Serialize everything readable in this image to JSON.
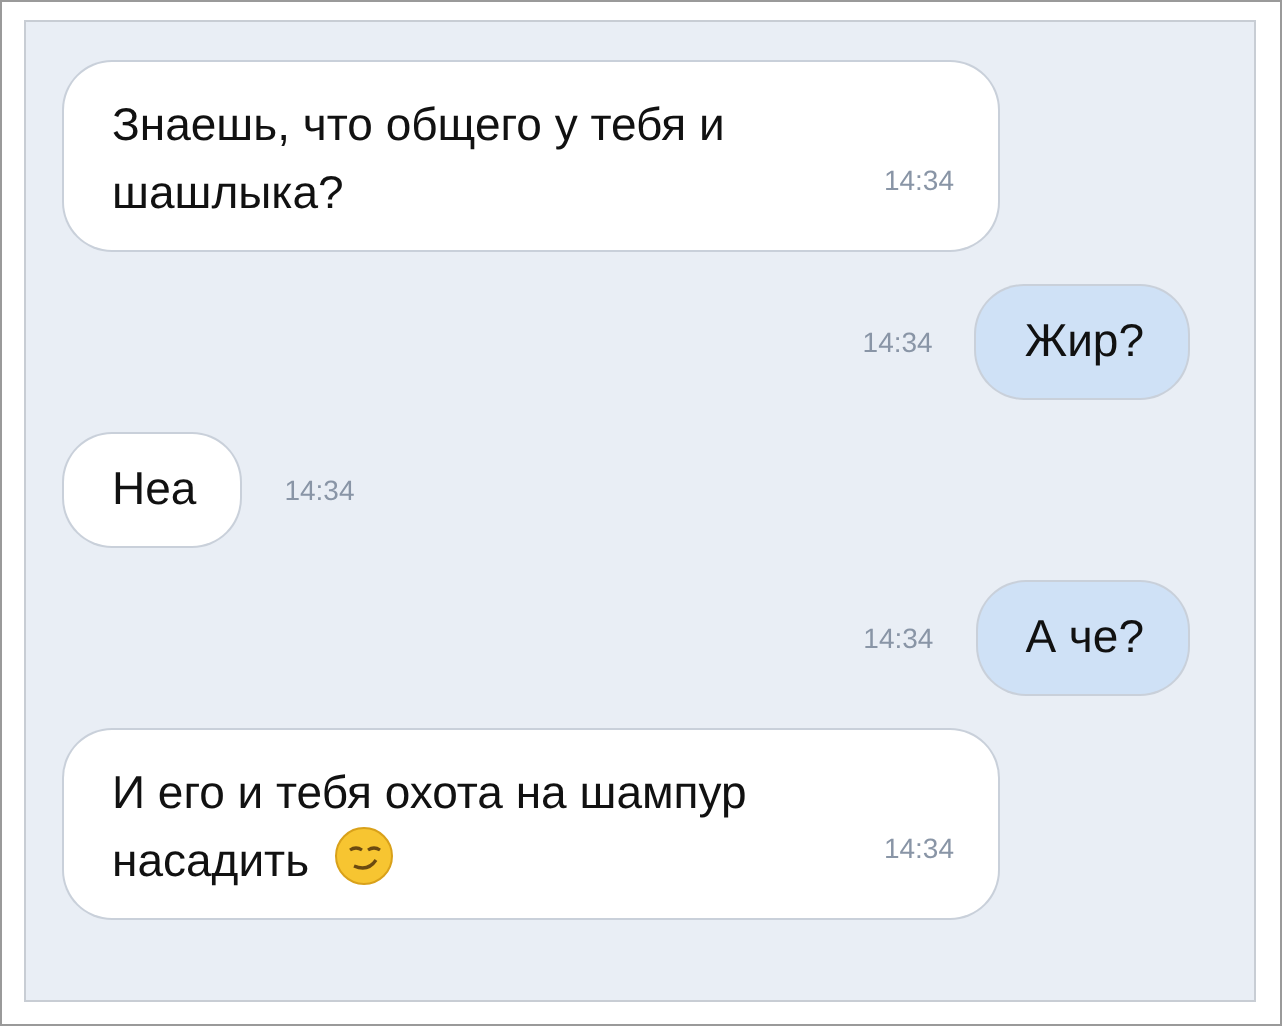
{
  "messages": [
    {
      "kind": "long",
      "text": "Знаешь, что общего у тебя и шашлыка?",
      "time": "14:34"
    },
    {
      "kind": "sent",
      "text": "Жир?",
      "time": "14:34"
    },
    {
      "kind": "received",
      "text": "Неа",
      "time": "14:34"
    },
    {
      "kind": "sent",
      "text": "А че?",
      "time": "14:34"
    },
    {
      "kind": "longsmirk",
      "text": "И его и тебя охота на шампур насадить",
      "time": "14:34"
    }
  ]
}
